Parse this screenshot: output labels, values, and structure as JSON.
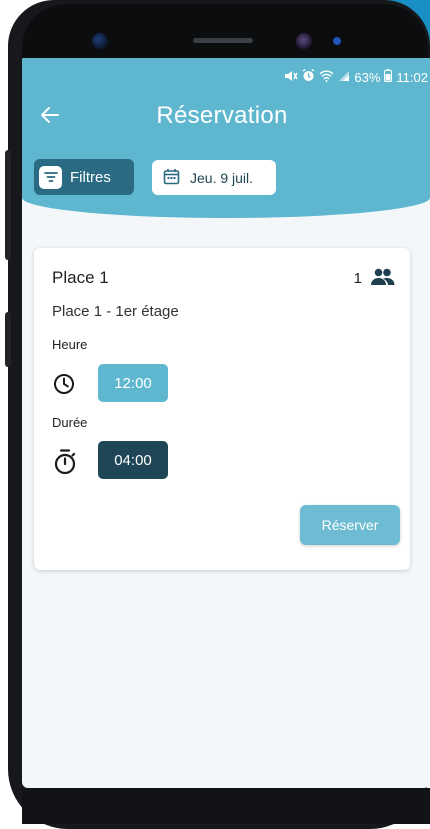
{
  "status_bar": {
    "battery": "63%",
    "time": "11:02"
  },
  "header": {
    "title": "Réservation",
    "back_icon": "arrow-left-icon"
  },
  "toolbar": {
    "filters_label": "Filtres",
    "date_label": "Jeu. 9 juil."
  },
  "card": {
    "title": "Place 1",
    "capacity": "1",
    "subtitle": "Place 1 - 1er étage",
    "time_label": "Heure",
    "time_value": "12:00",
    "duration_label": "Durée",
    "duration_value": "04:00",
    "reserve_label": "Réserver"
  },
  "colors": {
    "header_bg": "#5fb7cf",
    "filters_bg": "#2a6a82",
    "duration_chip": "#1f4656",
    "time_chip": "#5fb7cf"
  }
}
